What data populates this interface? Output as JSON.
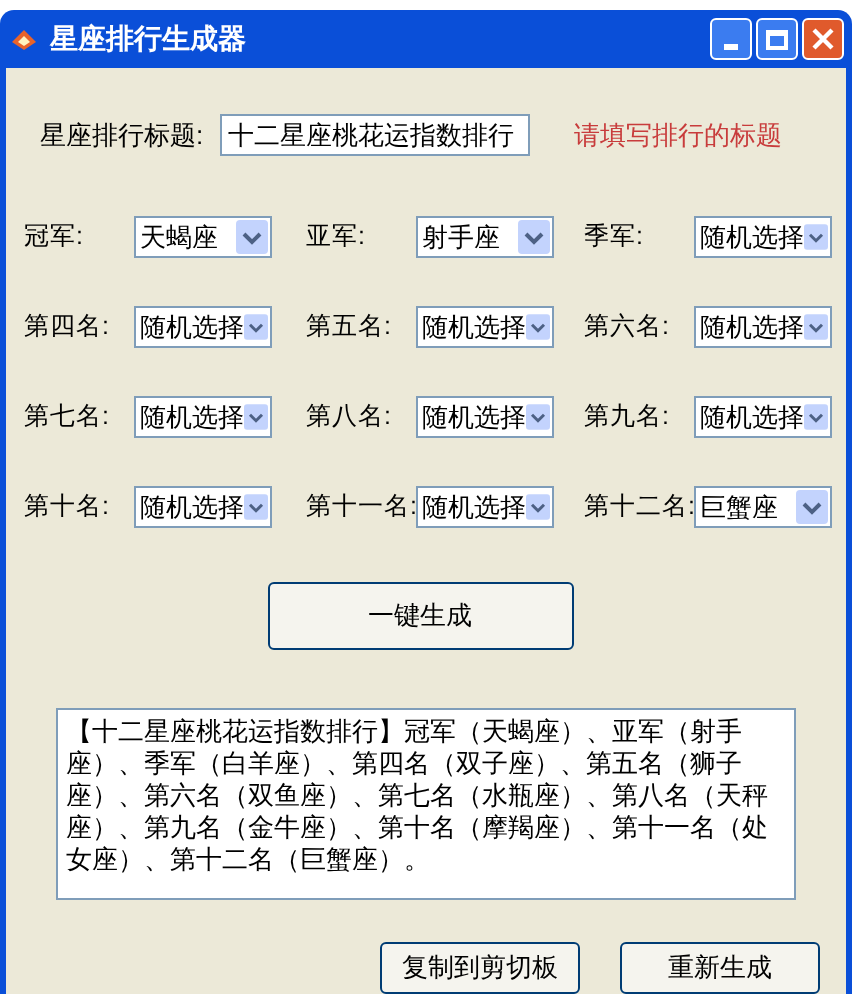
{
  "window": {
    "title": "星座排行生成器"
  },
  "title_field": {
    "label": "星座排行标题:",
    "value": "十二星座桃花运指数排行",
    "hint": "请填写排行的标题"
  },
  "ranks": [
    {
      "label": "冠军:",
      "value": "天蝎座"
    },
    {
      "label": "亚军:",
      "value": "射手座"
    },
    {
      "label": "季军:",
      "value": "随机选择"
    },
    {
      "label": "第四名:",
      "value": "随机选择"
    },
    {
      "label": "第五名:",
      "value": "随机选择"
    },
    {
      "label": "第六名:",
      "value": "随机选择"
    },
    {
      "label": "第七名:",
      "value": "随机选择"
    },
    {
      "label": "第八名:",
      "value": "随机选择"
    },
    {
      "label": "第九名:",
      "value": "随机选择"
    },
    {
      "label": "第十名:",
      "value": "随机选择"
    },
    {
      "label": "第十一名:",
      "value": "随机选择"
    },
    {
      "label": "第十二名:",
      "value": "巨蟹座"
    }
  ],
  "generate_button": "一键生成",
  "result": "【十二星座桃花运指数排行】冠军（天蝎座）、亚军（射手座）、季军（白羊座）、第四名（双子座）、第五名（狮子座）、第六名（双鱼座）、第七名（水瓶座）、第八名（天秤座）、第九名（金牛座）、第十名（摩羯座）、第十一名（处女座）、第十二名（巨蟹座）。",
  "buttons": [
    "复制到剪切板",
    "重新生成"
  ]
}
